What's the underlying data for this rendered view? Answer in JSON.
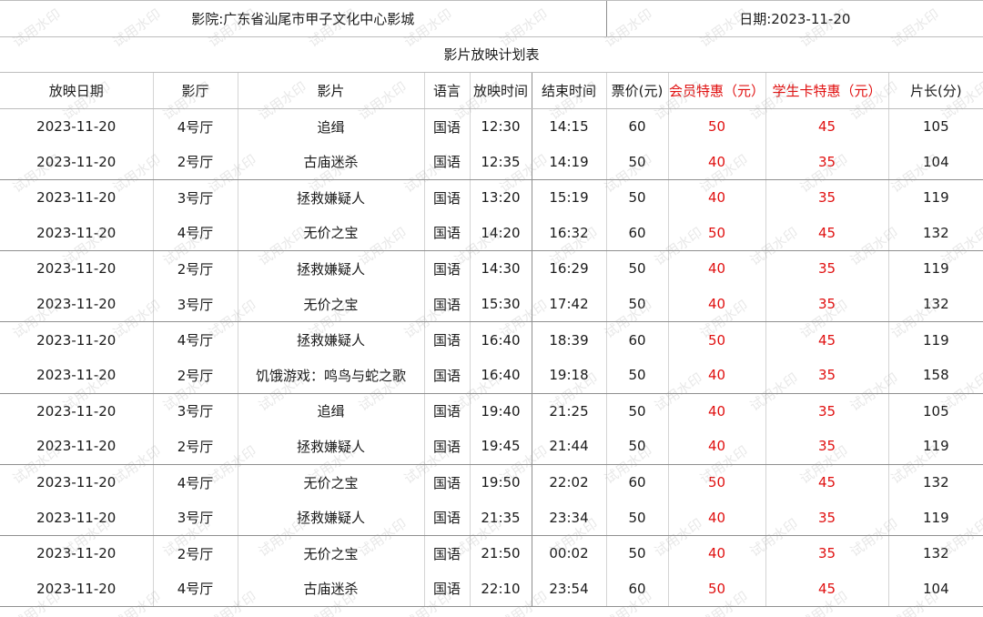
{
  "header": {
    "cinema": "影院:广东省汕尾市甲子文化中心影城",
    "date": "日期:2023-11-20"
  },
  "title": "影片放映计划表",
  "columns": [
    "放映日期",
    "影厅",
    "影片",
    "语言",
    "放映时间",
    "结束时间",
    "票价(元)",
    "会员特惠（元）",
    "学生卡特惠（元）",
    "片长(分)"
  ],
  "rows": [
    [
      "2023-11-20",
      "4号厅",
      "追缉",
      "国语",
      "12:30",
      "14:15",
      "60",
      "50",
      "45",
      "105"
    ],
    [
      "2023-11-20",
      "2号厅",
      "古庙迷杀",
      "国语",
      "12:35",
      "14:19",
      "50",
      "40",
      "35",
      "104"
    ],
    [
      "2023-11-20",
      "3号厅",
      "拯救嫌疑人",
      "国语",
      "13:20",
      "15:19",
      "50",
      "40",
      "35",
      "119"
    ],
    [
      "2023-11-20",
      "4号厅",
      "无价之宝",
      "国语",
      "14:20",
      "16:32",
      "60",
      "50",
      "45",
      "132"
    ],
    [
      "2023-11-20",
      "2号厅",
      "拯救嫌疑人",
      "国语",
      "14:30",
      "16:29",
      "50",
      "40",
      "35",
      "119"
    ],
    [
      "2023-11-20",
      "3号厅",
      "无价之宝",
      "国语",
      "15:30",
      "17:42",
      "50",
      "40",
      "35",
      "132"
    ],
    [
      "2023-11-20",
      "4号厅",
      "拯救嫌疑人",
      "国语",
      "16:40",
      "18:39",
      "60",
      "50",
      "45",
      "119"
    ],
    [
      "2023-11-20",
      "2号厅",
      "饥饿游戏：鸣鸟与蛇之歌",
      "国语",
      "16:40",
      "19:18",
      "50",
      "40",
      "35",
      "158"
    ],
    [
      "2023-11-20",
      "3号厅",
      "追缉",
      "国语",
      "19:40",
      "21:25",
      "50",
      "40",
      "35",
      "105"
    ],
    [
      "2023-11-20",
      "2号厅",
      "拯救嫌疑人",
      "国语",
      "19:45",
      "21:44",
      "50",
      "40",
      "35",
      "119"
    ],
    [
      "2023-11-20",
      "4号厅",
      "无价之宝",
      "国语",
      "19:50",
      "22:02",
      "60",
      "50",
      "45",
      "132"
    ],
    [
      "2023-11-20",
      "3号厅",
      "拯救嫌疑人",
      "国语",
      "21:35",
      "23:34",
      "50",
      "40",
      "35",
      "119"
    ],
    [
      "2023-11-20",
      "2号厅",
      "无价之宝",
      "国语",
      "21:50",
      "00:02",
      "50",
      "40",
      "35",
      "132"
    ],
    [
      "2023-11-20",
      "4号厅",
      "古庙迷杀",
      "国语",
      "22:10",
      "23:54",
      "60",
      "50",
      "45",
      "104"
    ]
  ],
  "watermark": "试用水印",
  "colors": {
    "discount": "#e01010",
    "text": "#1a1a1a"
  }
}
